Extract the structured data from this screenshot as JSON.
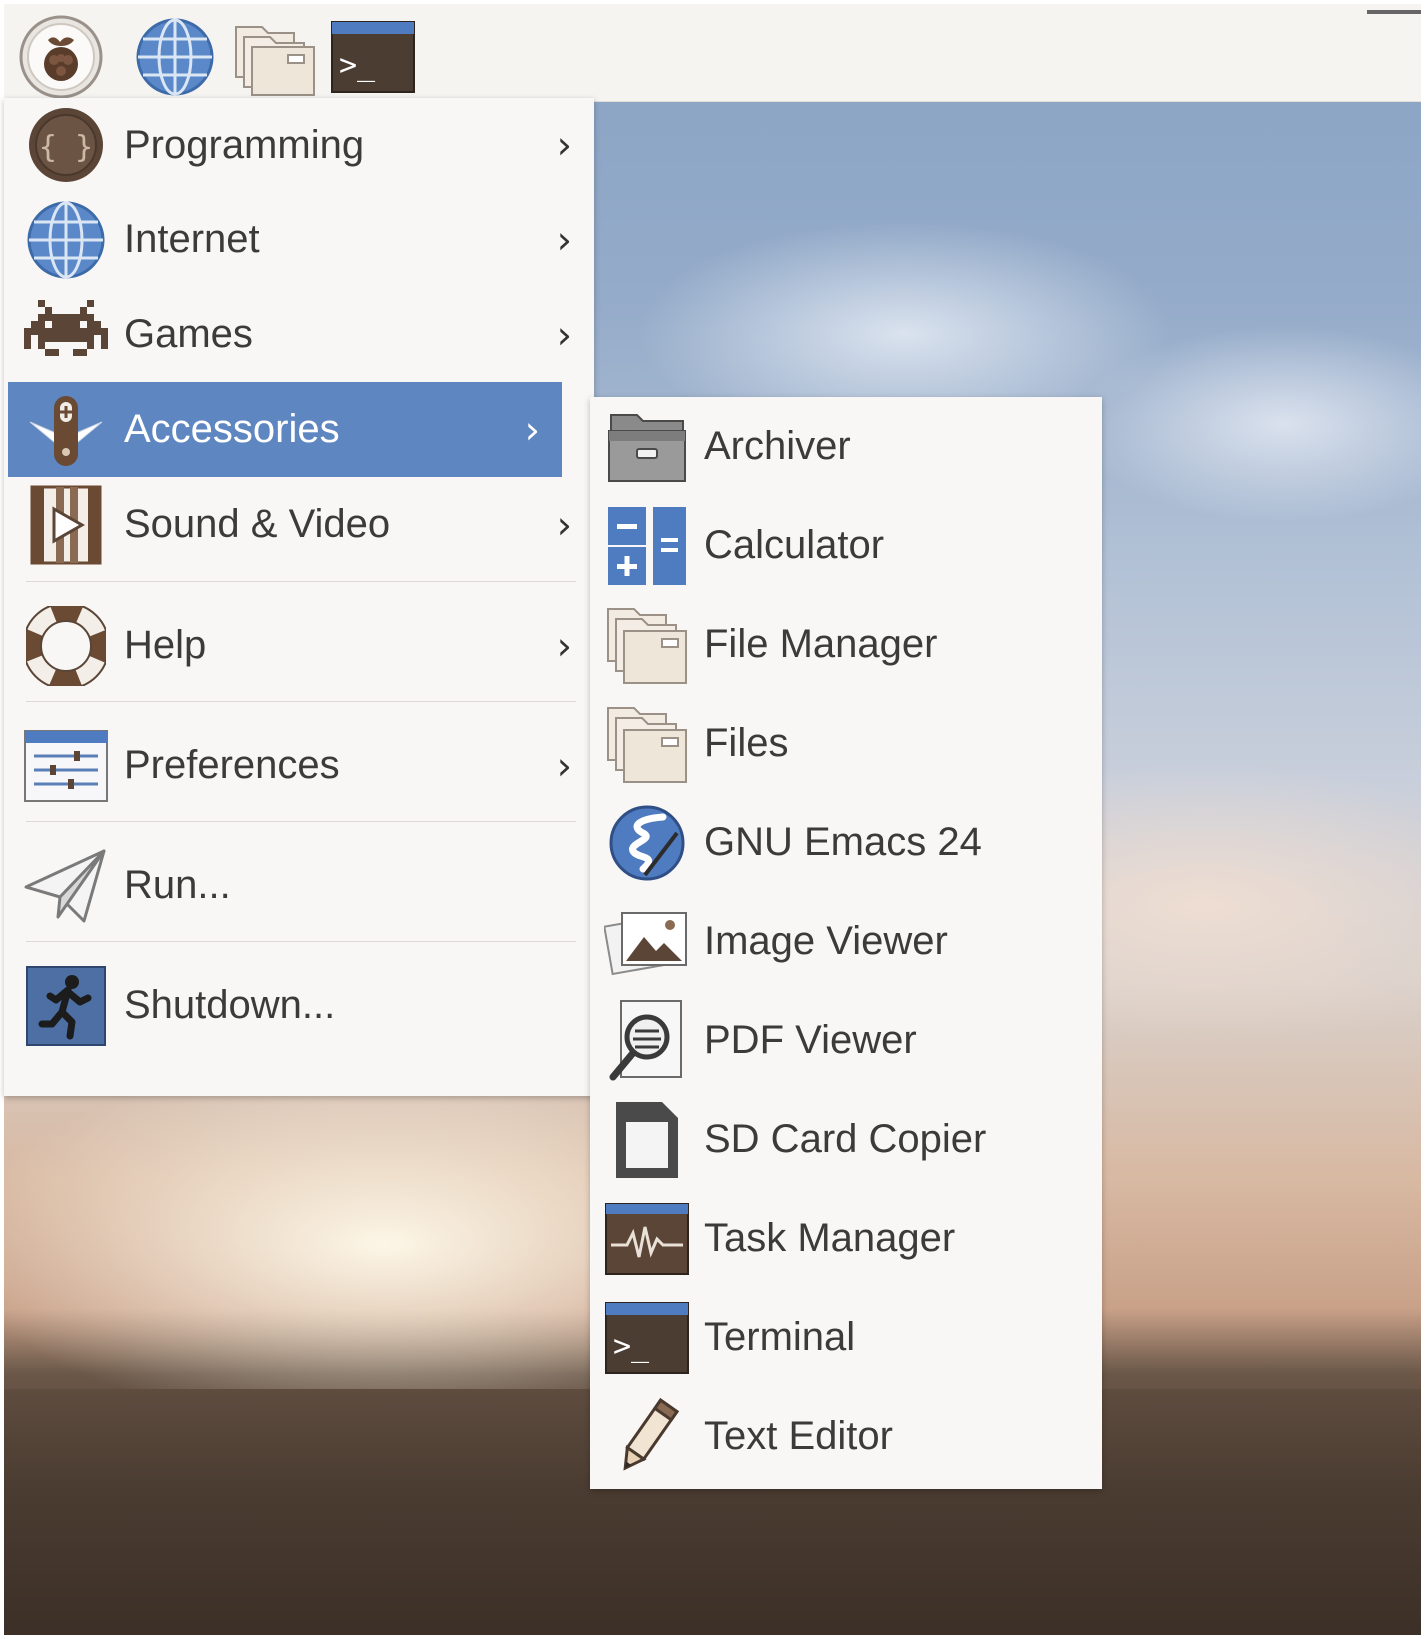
{
  "panel": {
    "launchers": [
      {
        "icon": "raspberry-menu-icon"
      },
      {
        "icon": "web-browser-icon"
      },
      {
        "icon": "file-manager-icon"
      },
      {
        "icon": "terminal-icon"
      }
    ]
  },
  "main_menu": {
    "items": [
      {
        "label": "Programming",
        "icon": "programming-icon",
        "has_submenu": true
      },
      {
        "label": "Internet",
        "icon": "globe-icon",
        "has_submenu": true
      },
      {
        "label": "Games",
        "icon": "space-invader-icon",
        "has_submenu": true
      },
      {
        "label": "Accessories",
        "icon": "pocket-knife-icon",
        "has_submenu": true,
        "selected": true
      },
      {
        "label": "Sound & Video",
        "icon": "film-play-icon",
        "has_submenu": true
      },
      {
        "label": "Help",
        "icon": "lifebuoy-icon",
        "has_submenu": true
      },
      {
        "label": "Preferences",
        "icon": "sliders-icon",
        "has_submenu": true
      },
      {
        "label": "Run...",
        "icon": "paper-plane-icon",
        "has_submenu": false
      },
      {
        "label": "Shutdown...",
        "icon": "running-man-icon",
        "has_submenu": false
      }
    ],
    "arrow": "›"
  },
  "accessories_menu": {
    "items": [
      {
        "label": "Archiver",
        "icon": "archive-box-icon"
      },
      {
        "label": "Calculator",
        "icon": "calculator-icon"
      },
      {
        "label": "File Manager",
        "icon": "folder-icon"
      },
      {
        "label": "Files",
        "icon": "folder-icon"
      },
      {
        "label": "GNU Emacs 24",
        "icon": "emacs-icon"
      },
      {
        "label": "Image Viewer",
        "icon": "image-viewer-icon"
      },
      {
        "label": "PDF Viewer",
        "icon": "pdf-magnifier-icon"
      },
      {
        "label": "SD Card Copier",
        "icon": "sd-card-icon"
      },
      {
        "label": "Task Manager",
        "icon": "task-monitor-icon"
      },
      {
        "label": "Terminal",
        "icon": "terminal-icon"
      },
      {
        "label": "Text Editor",
        "icon": "pencil-icon"
      }
    ]
  },
  "terminal_prompt": ">_",
  "colors": {
    "selection": "#5e86c0",
    "menu_bg": "#f8f7f5",
    "panel_bg": "#f6f4f1",
    "icon_brown": "#5a4536",
    "icon_blue": "#4f7cc0"
  }
}
